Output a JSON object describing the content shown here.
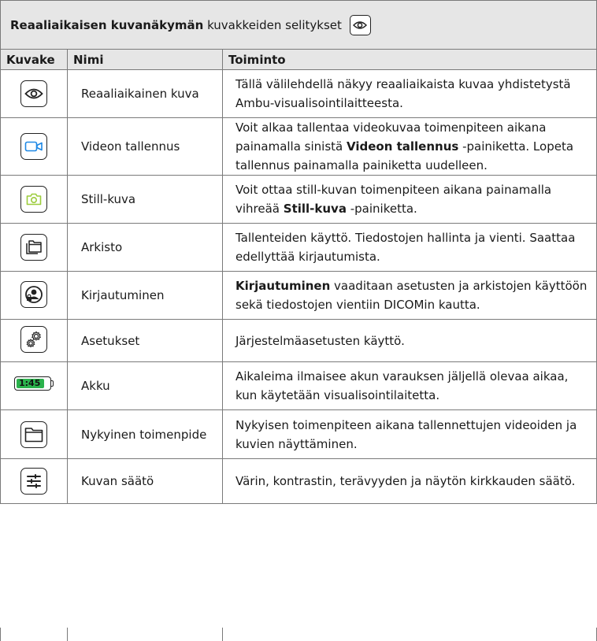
{
  "title": {
    "bold": "Reaaliaikaisen kuvanäkymän",
    "rest": " kuvakkeiden selitykset",
    "icon": "eye-icon"
  },
  "columns": [
    "Kuvake",
    "Nimi",
    "Toiminto"
  ],
  "rows": [
    {
      "icon": "eye-icon",
      "name": "Reaaliaikainen kuva",
      "func": [
        {
          "t": "Tällä välilehdellä näkyy reaaliaikaista kuvaa yhdistetystä Ambu-visualisointilaitteesta.",
          "b": false
        }
      ]
    },
    {
      "icon": "video-camera-icon",
      "name": "Videon tallennus",
      "func": [
        {
          "t": "Voit alkaa tallentaa videokuvaa toimenpiteen aikana painamalla sinistä ",
          "b": false
        },
        {
          "t": "Videon tallennus",
          "b": true
        },
        {
          "t": " -painiketta. Lopeta tallennus painamalla painiketta uudelleen.",
          "b": false
        }
      ]
    },
    {
      "icon": "photo-camera-icon",
      "name": "Still-kuva",
      "func": [
        {
          "t": "Voit ottaa still-kuvan toimenpiteen aikana painamalla vihreää ",
          "b": false
        },
        {
          "t": "Still-kuva",
          "b": true
        },
        {
          "t": " -painiketta.",
          "b": false
        }
      ]
    },
    {
      "icon": "archive-folders-icon",
      "name": "Arkisto",
      "func": [
        {
          "t": "Tallenteiden käyttö. Tiedostojen hallinta ja vienti. Saattaa edellyttää kirjautumista.",
          "b": false
        }
      ]
    },
    {
      "icon": "user-lock-icon",
      "name": "Kirjautuminen",
      "func": [
        {
          "t": "Kirjautuminen",
          "b": true
        },
        {
          "t": " vaaditaan asetusten ja arkistojen käyttöön sekä tiedostojen vientiin DICOMin kautta.",
          "b": false
        }
      ]
    },
    {
      "icon": "gears-icon",
      "name": "Asetukset",
      "func": [
        {
          "t": "Järjestelmäasetusten käyttö.",
          "b": false
        }
      ]
    },
    {
      "icon": "battery-icon",
      "battery_label": "1:45",
      "battery_level": 0.85,
      "name": "Akku",
      "func": [
        {
          "t": "Aikaleima ilmaisee akun varauksen jäljellä olevaa aikaa, kun käytetään visualisointilaitetta.",
          "b": false
        }
      ]
    },
    {
      "icon": "folder-icon",
      "name": "Nykyinen toimenpide",
      "func": [
        {
          "t": "Nykyisen toimenpiteen aikana tallennettujen videoiden ja kuvien näyttäminen.",
          "b": false
        }
      ]
    },
    {
      "icon": "sliders-icon",
      "name": "Kuvan säätö",
      "func": [
        {
          "t": "Värin, kontrastin, terävyyden ja näytön kirkkauden säätö.",
          "b": false
        }
      ]
    }
  ],
  "colors": {
    "header_bg": "#e6e6e6",
    "border": "#7a7a7a",
    "video_blue": "#1e88e5",
    "camera_green": "#9ccc3c",
    "battery_green": "#2bb24c"
  }
}
